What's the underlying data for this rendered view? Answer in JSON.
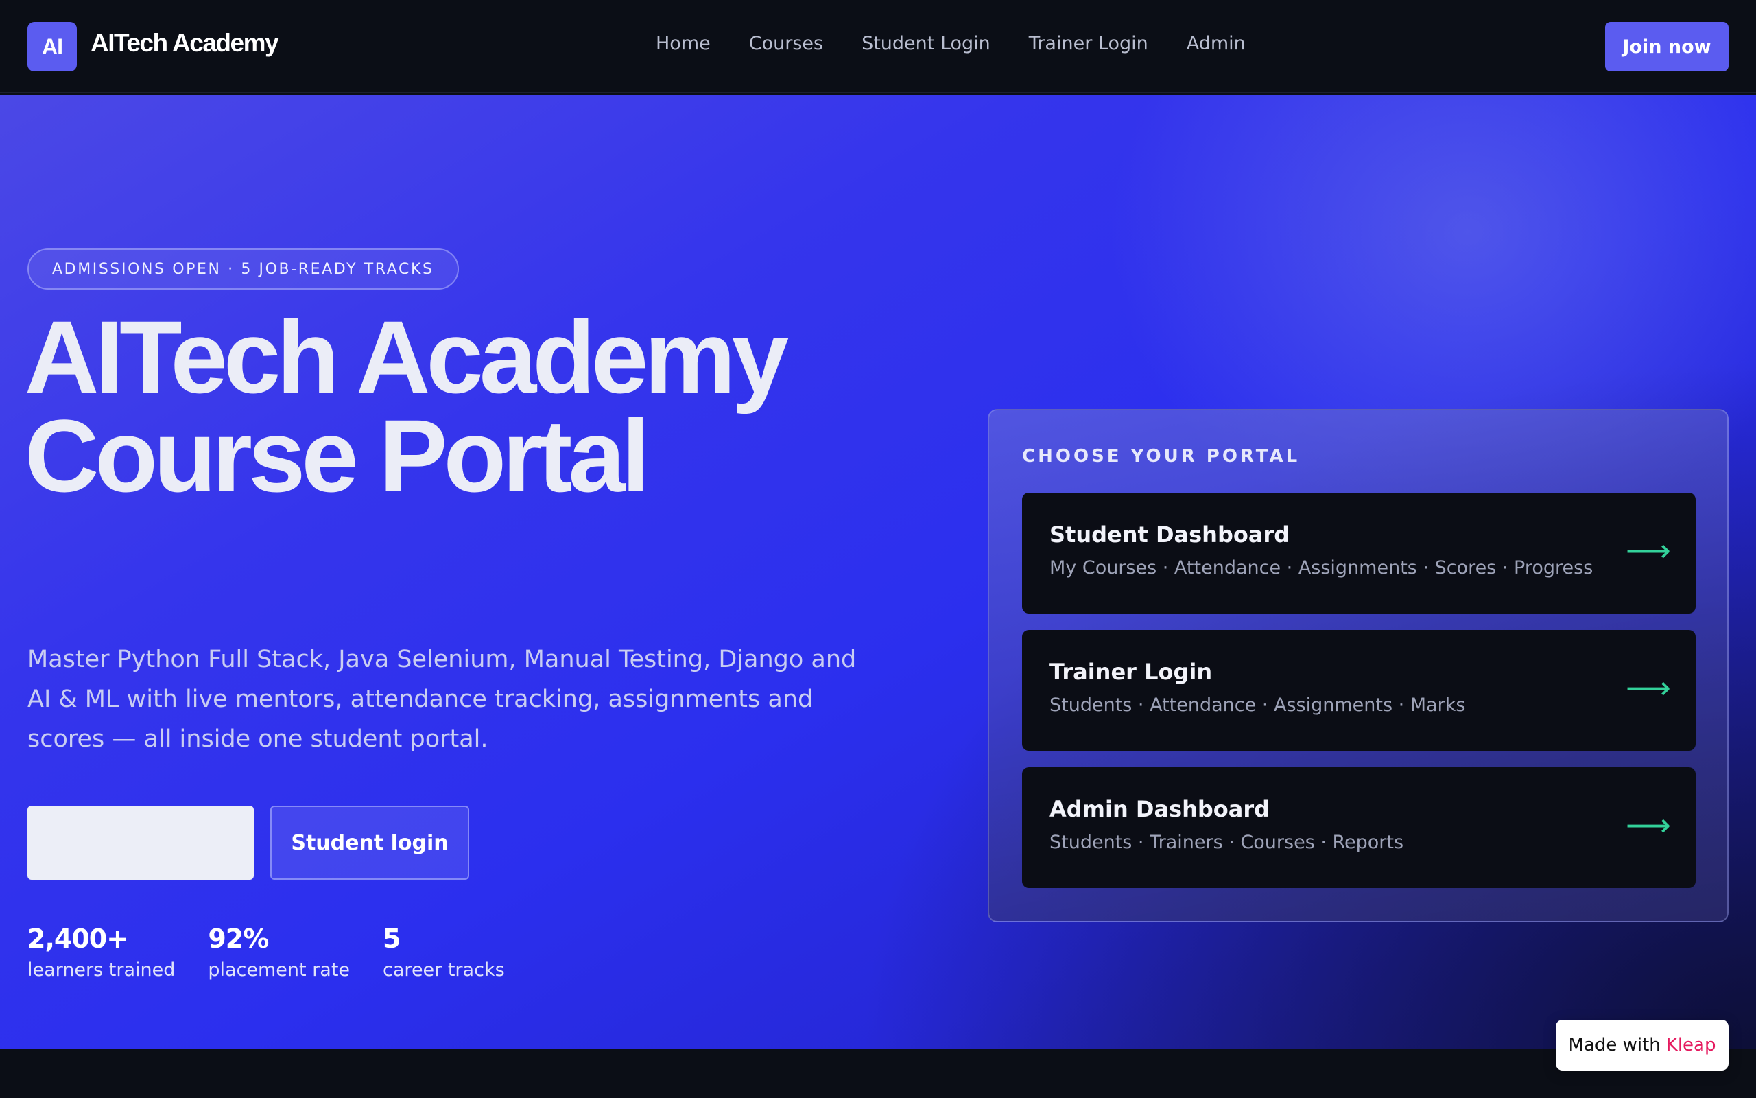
{
  "nav": {
    "logo_text": "AI",
    "brand": "AITech Academy",
    "links": [
      "Home",
      "Courses",
      "Student Login",
      "Trainer Login",
      "Admin"
    ],
    "cta": "Join now"
  },
  "hero": {
    "badge": "ADMISSIONS OPEN · 5 JOB-READY TRACKS",
    "title_line1": "AITech Academy",
    "title_line2": "Course Portal",
    "description": "Master Python Full Stack, Java Selenium, Manual Testing, Django and AI & ML with live mentors, attendance tracking, assignments and scores — all inside one student portal.",
    "primary_button_label": "",
    "secondary_button_label": "Student login",
    "stats": [
      {
        "value": "2,400+",
        "label": "learners trained"
      },
      {
        "value": "92%",
        "label": "placement rate"
      },
      {
        "value": "5",
        "label": "career tracks"
      }
    ]
  },
  "portal": {
    "heading": "CHOOSE YOUR PORTAL",
    "items": [
      {
        "title": "Student Dashboard",
        "subtitle": "My Courses · Attendance · Assignments · Scores · Progress",
        "arrow": "⟶"
      },
      {
        "title": "Trainer Login",
        "subtitle": "Students · Attendance · Assignments · Marks",
        "arrow": "⟶"
      },
      {
        "title": "Admin Dashboard",
        "subtitle": "Students · Trainers · Courses · Reports",
        "arrow": "⟶"
      }
    ]
  },
  "footer": {
    "made_with": "Made with",
    "kleap": "Kleap"
  },
  "colors": {
    "accent": "#5b5cf0",
    "arrow": "#33d19a",
    "kleap": "#e5195e"
  }
}
